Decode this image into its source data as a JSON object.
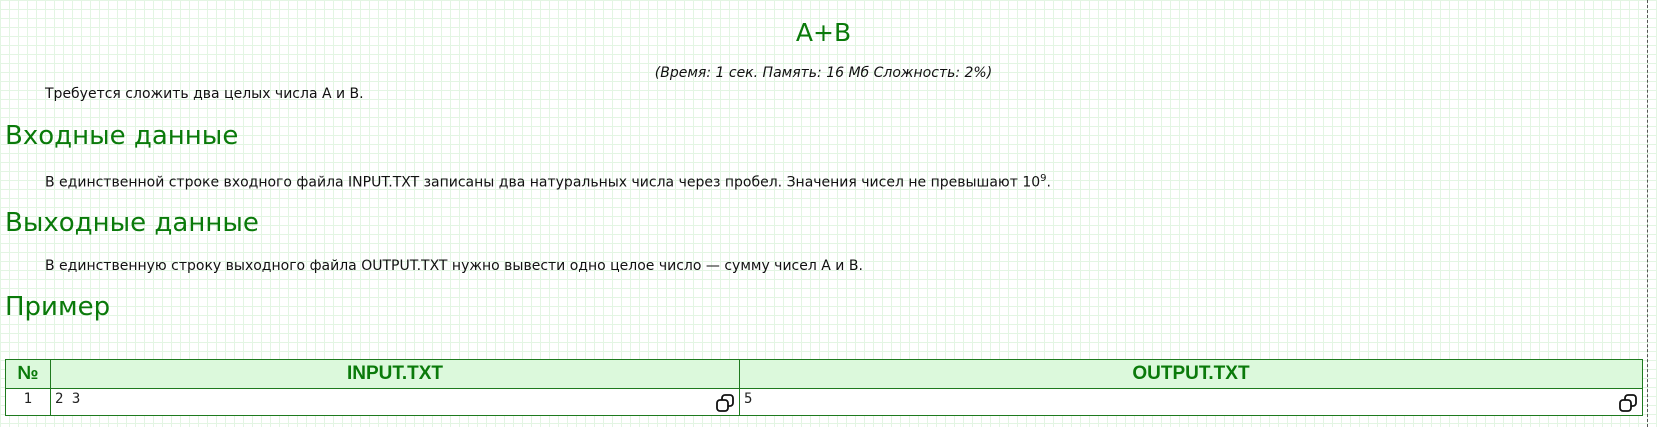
{
  "problem": {
    "title": "A+B",
    "limits": "(Время: 1 сек. Память: 16 Мб Сложность: 2%)",
    "statement": "Требуется сложить два целых числа А и В."
  },
  "input_section": {
    "heading": "Входные данные",
    "text": "В единственной строке входного файла INPUT.TXT записаны два натуральных числа через пробел. Значения чисел не превышают 10",
    "exponent": "9",
    "suffix": "."
  },
  "output_section": {
    "heading": "Выходные данные",
    "text": "В единственную строку выходного файла OUTPUT.TXT нужно вывести одно целое число — сумму чисел A и B."
  },
  "example": {
    "heading": "Пример",
    "columns": [
      "№",
      "INPUT.TXT",
      "OUTPUT.TXT"
    ],
    "rows": [
      {
        "num": "1",
        "input": "2 3",
        "output": "5"
      }
    ]
  },
  "icons": {
    "copy": "copy-icon"
  },
  "colors": {
    "accent": "#0a7a0a",
    "header_bg": "#dcf9dc",
    "border": "#1e7a1e"
  }
}
